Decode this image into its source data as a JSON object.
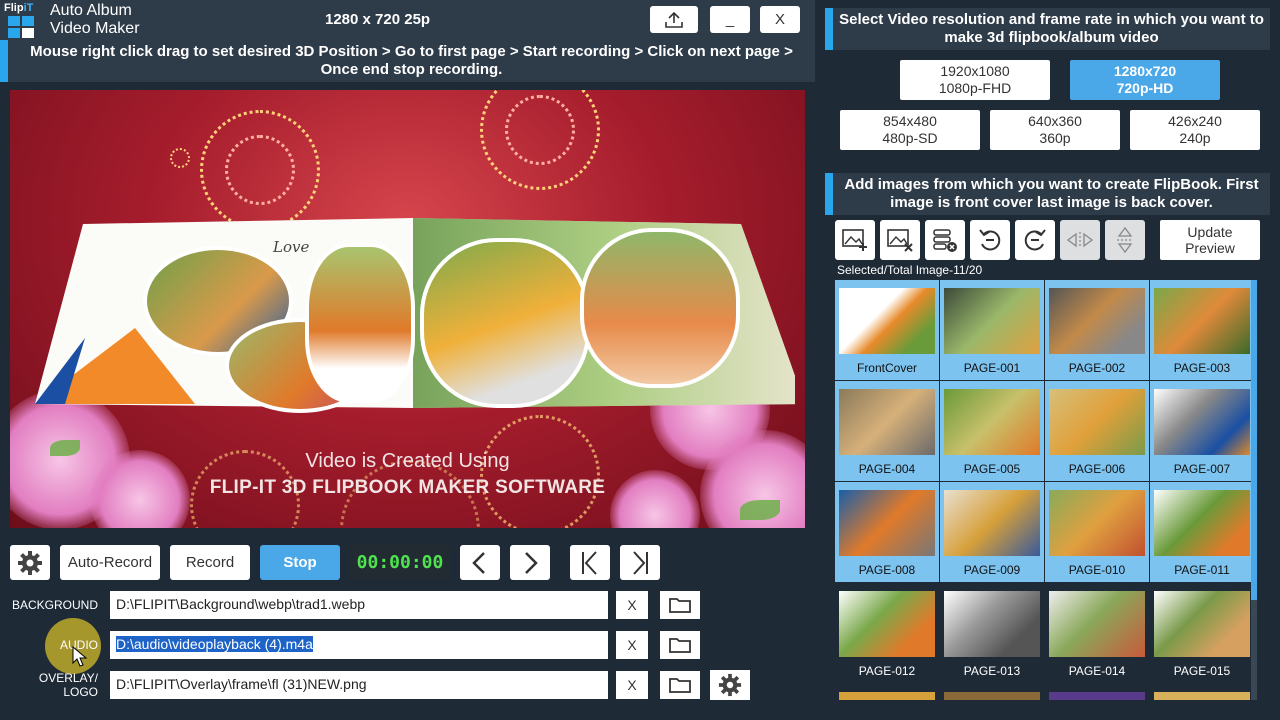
{
  "app": {
    "logo_part1": "Flip",
    "logo_part2": "iT",
    "title_line1": "Auto Album",
    "title_line2": "Video Maker",
    "resolution_label": "1280 x 720 25p",
    "min_label": "_",
    "close_label": "X"
  },
  "instruction": "Mouse right click drag to set desired 3D Position > Go to first page > Start recording > Click on next page > Once end stop recording.",
  "preview": {
    "watermark_line1": "Video is Created Using",
    "watermark_line2": "FLIP-IT 3D FLIPBOOK MAKER SOFTWARE",
    "book_script": "Love"
  },
  "controls": {
    "auto_record": "Auto-Record",
    "record": "Record",
    "stop": "Stop",
    "timer": "00:00:00"
  },
  "paths": {
    "background_label": "BACKGROUND",
    "background_value": "D:\\FLIPIT\\Background\\webp\\trad1.webp",
    "audio_label": "AUDIO",
    "audio_value": "D:\\audio\\videoplayback (4).m4a",
    "overlay_label1": "OVERLAY/",
    "overlay_label2": "LOGO",
    "overlay_value": "D:\\FLIPIT\\Overlay\\frame\\fl (31)NEW.png",
    "clear_label": "X"
  },
  "resolution_panel": {
    "heading": "Select Video resolution and frame rate in which you want to make 3d flipbook/album video",
    "options": [
      {
        "line1": "1920x1080",
        "line2": "1080p-FHD",
        "active": false
      },
      {
        "line1": "1280x720",
        "line2": "720p-HD",
        "active": true
      },
      {
        "line1": "854x480",
        "line2": "480p-SD",
        "active": false
      },
      {
        "line1": "640x360",
        "line2": "360p",
        "active": false
      },
      {
        "line1": "426x240",
        "line2": "240p",
        "active": false
      }
    ]
  },
  "images_panel": {
    "heading": "Add images from which you want to create FlipBook. First image is front cover last image is back cover.",
    "update_line1": "Update",
    "update_line2": "Preview",
    "count_label": "Selected/Total Image-11/20",
    "thumbs": [
      {
        "label": "FrontCover",
        "selected": true
      },
      {
        "label": "PAGE-001",
        "selected": true
      },
      {
        "label": "PAGE-002",
        "selected": true
      },
      {
        "label": "PAGE-003",
        "selected": true
      },
      {
        "label": "PAGE-004",
        "selected": true
      },
      {
        "label": "PAGE-005",
        "selected": true
      },
      {
        "label": "PAGE-006",
        "selected": true
      },
      {
        "label": "PAGE-007",
        "selected": true
      },
      {
        "label": "PAGE-008",
        "selected": true
      },
      {
        "label": "PAGE-009",
        "selected": true
      },
      {
        "label": "PAGE-010",
        "selected": true
      },
      {
        "label": "PAGE-011",
        "selected": true
      },
      {
        "label": "PAGE-012",
        "selected": false
      },
      {
        "label": "PAGE-013",
        "selected": false
      },
      {
        "label": "PAGE-014",
        "selected": false
      },
      {
        "label": "PAGE-015",
        "selected": false
      }
    ]
  }
}
